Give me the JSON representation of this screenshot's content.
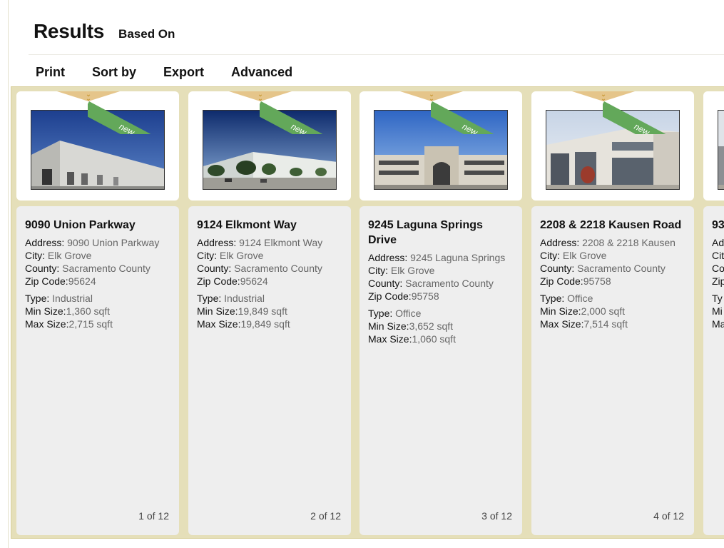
{
  "header": {
    "title": "Results",
    "subtitle": "Based On"
  },
  "toolbar": {
    "print": "Print",
    "sort": "Sort by",
    "export": "Export",
    "advanced": "Advanced"
  },
  "ribbon_label": "new",
  "colors": {
    "strip": "#e5dfb9",
    "ribbon": "#63a85a",
    "card": "#eeeeee",
    "pointer": "#e5c58a"
  },
  "cards": [
    {
      "name": "9090 Union Parkway",
      "address_label": "Address:",
      "address": "9090 Union Parkway",
      "city_label": "City:",
      "city": "Elk Grove",
      "county_label": "County:",
      "county": "Sacramento County",
      "zip_label": "Zip Code:",
      "zip": "95624",
      "type_label": "Type:",
      "type": "Industrial",
      "min_label": "Min Size:",
      "min": "1,360 sqft",
      "max_label": "Max Size:",
      "max": "2,715 sqft",
      "pager": "1 of 12"
    },
    {
      "name": "9124 Elkmont Way",
      "address_label": "Address:",
      "address": "9124 Elkmont Way",
      "city_label": "City:",
      "city": "Elk Grove",
      "county_label": "County:",
      "county": "Sacramento County",
      "zip_label": "Zip Code:",
      "zip": "95624",
      "type_label": "Type:",
      "type": "Industrial",
      "min_label": "Min Size:",
      "min": "19,849 sqft",
      "max_label": "Max Size:",
      "max": "19,849 sqft",
      "pager": "2 of 12"
    },
    {
      "name": "9245 Laguna Springs Drive",
      "address_label": "Address:",
      "address": "9245 Laguna Springs",
      "city_label": "City:",
      "city": "Elk Grove",
      "county_label": "County:",
      "county": "Sacramento County",
      "zip_label": "Zip Code:",
      "zip": "95758",
      "type_label": "Type:",
      "type": "Office",
      "min_label": "Min Size:",
      "min": "3,652 sqft",
      "max_label": "Max Size:",
      "max": "1,060 sqft",
      "pager": "3 of 12"
    },
    {
      "name": "2208 & 2218 Kausen Road",
      "address_label": "Address:",
      "address": "2208 & 2218 Kausen",
      "city_label": "City:",
      "city": "Elk Grove",
      "county_label": "County:",
      "county": "Sacramento County",
      "zip_label": "Zip Code:",
      "zip": "95758",
      "type_label": "Type:",
      "type": "Office",
      "min_label": "Min Size:",
      "min": "2,000 sqft",
      "max_label": "Max Size:",
      "max": "7,514 sqft",
      "pager": "4 of 12"
    },
    {
      "name": "93",
      "address_label": "Ad",
      "city_label": "Cit",
      "county_label": "Co",
      "zip_label": "Zip",
      "type_label": "Ty",
      "min_label": "Mi",
      "max_label": "Ma"
    }
  ]
}
